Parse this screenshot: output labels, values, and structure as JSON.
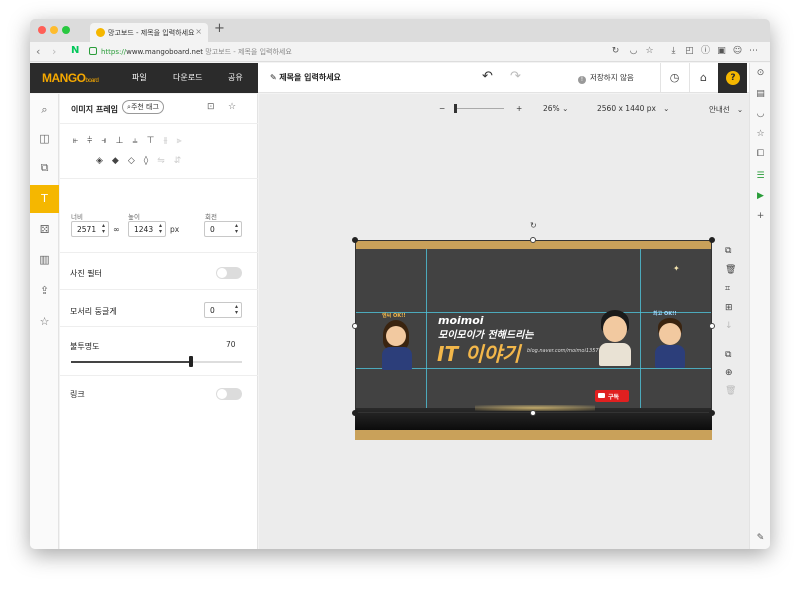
{
  "browser": {
    "tab_title": "망고보드 - 제목을 입력하세요",
    "url_scheme": "https://",
    "url_host": "www.mangoboard.net",
    "url_page_title": "망고보드 - 제목을 입력하세요",
    "naver_logo": "N"
  },
  "app": {
    "logo": "MANGO",
    "logo_suffix": "board",
    "menu": [
      "파일",
      "다운로드",
      "공유"
    ],
    "doc_title": "제목을 입력하세요",
    "save_status": "저장하지 않음",
    "help": "?"
  },
  "panel": {
    "title": "이미지 프레임",
    "tag_button": "주천 태그",
    "width_label": "너비",
    "height_label": "높이",
    "rotation_label": "회전",
    "width": "2571",
    "height": "1243",
    "unit": "px",
    "rotation": "0",
    "photo_filter": "사진 필터",
    "corner_round": "모서리 둥글게",
    "corner_value": "0",
    "opacity_label": "불투명도",
    "opacity_value": "70",
    "opacity_fraction": 0.7,
    "link": "링크"
  },
  "canvas_toolbar": {
    "zoom_minus": "−",
    "zoom_plus": "+",
    "zoom_percent": "26%",
    "size": "2560 x 1440 px",
    "guides": "안내선"
  },
  "design": {
    "text_en": "moimoi",
    "text_ko": "모이모이가 전해드리는",
    "text_big": "IT 이야기",
    "blog_url": "blog.naver.com/moimoi1357",
    "subscribe": "구독",
    "badge_left": "엔씨 OK!!",
    "badge_right": "최고 OK!!"
  }
}
